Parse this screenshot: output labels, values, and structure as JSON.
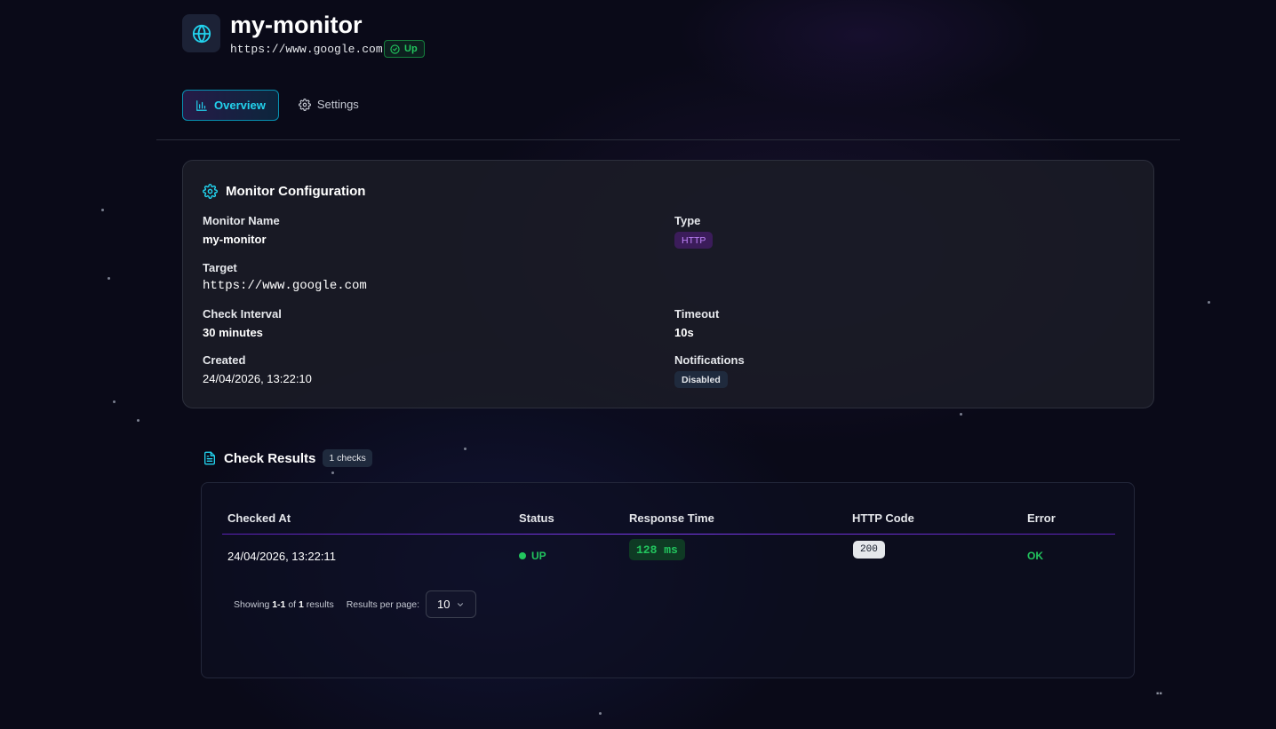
{
  "monitor": {
    "name": "my-monitor",
    "url": "https://www.google.com",
    "status": "Up"
  },
  "tabs": [
    {
      "label": "Overview",
      "icon": "bar-chart-icon",
      "active": true
    },
    {
      "label": "Settings",
      "icon": "gear-icon",
      "active": false
    }
  ],
  "config": {
    "title": "Monitor Configuration",
    "fields": {
      "name": {
        "label": "Monitor Name",
        "value": "my-monitor"
      },
      "type": {
        "label": "Type",
        "value": "HTTP"
      },
      "target": {
        "label": "Target",
        "value": "https://www.google.com"
      },
      "interval": {
        "label": "Check Interval",
        "value": "30 minutes"
      },
      "timeout": {
        "label": "Timeout",
        "value": "10s"
      },
      "created": {
        "label": "Created",
        "value": "24/04/2026, 13:22:10"
      },
      "notifications": {
        "label": "Notifications",
        "value": "Disabled"
      }
    }
  },
  "results": {
    "title": "Check Results",
    "count_label": "1 checks",
    "columns": [
      "Checked At",
      "Status",
      "Response Time",
      "HTTP Code",
      "Error"
    ],
    "rows": [
      {
        "checked_at": "24/04/2026, 13:22:11",
        "status": "UP",
        "response_time": "128 ms",
        "http_code": "200",
        "error": "OK"
      }
    ],
    "pagination": {
      "showing_prefix": "Showing",
      "range": "1-1",
      "of": "of",
      "total": "1",
      "suffix": "results",
      "per_page_label": "Results per page:",
      "per_page_value": "10"
    }
  },
  "colors": {
    "accent_cyan": "#22d3ee",
    "success": "#22c55e",
    "purple": "#c084fc",
    "background": "#0a0a18"
  }
}
